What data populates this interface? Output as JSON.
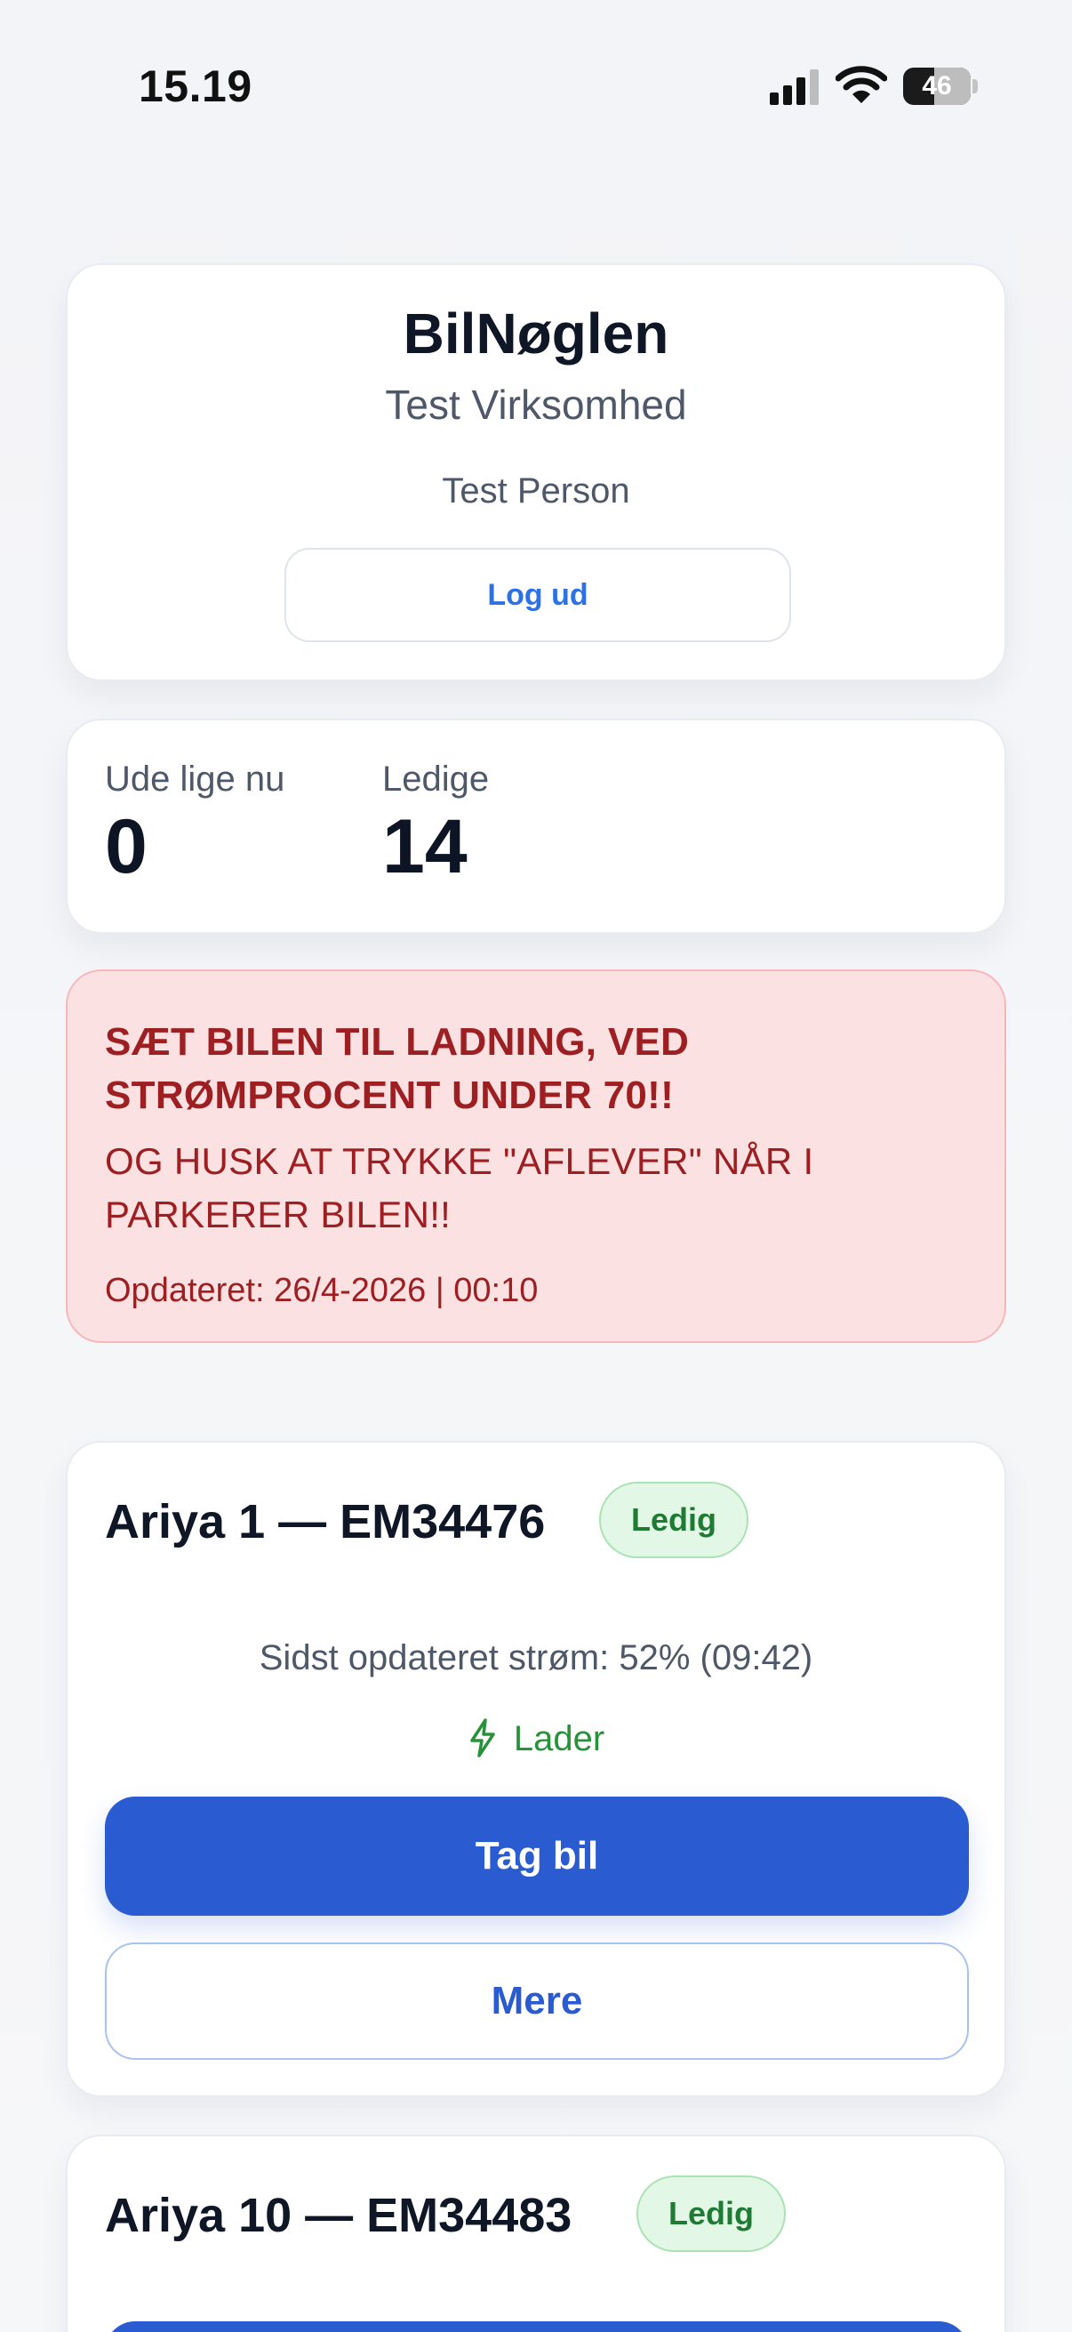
{
  "status_bar": {
    "time": "15.19",
    "battery_level": "46",
    "battery_fraction": 0.46
  },
  "header": {
    "app_title": "BilNøglen",
    "company": "Test Virksomhed",
    "person": "Test Person",
    "logout_label": "Log ud"
  },
  "stats": {
    "out_label": "Ude lige nu",
    "out_value": "0",
    "free_label": "Ledige",
    "free_value": "14"
  },
  "notice": {
    "headline": "SÆT BILEN TIL LADNING, VED STRØMPROCENT UNDER 70!!",
    "body": "OG HUSK AT TRYKKE \"AFLEVER\" NÅR I PARKERER BILEN!!",
    "updated": "Opdateret: 26/4-2026 | 00:10"
  },
  "cars": [
    {
      "title": "Ariya 1 — EM34476",
      "status": "Ledig",
      "battery_update": "Sidst opdateret strøm: 52% (09:42)",
      "charging": "Lader",
      "take_label": "Tag bil",
      "more_label": "Mere"
    },
    {
      "title": "Ariya 10 — EM34483",
      "status": "Ledig"
    }
  ],
  "colors": {
    "accent": "#2a5bd1",
    "link": "#2c72e6",
    "alert_text": "#9e1f22",
    "alert_bg": "#fbe1e2",
    "success": "#1f7a33"
  },
  "icons": [
    "signal-icon",
    "wifi-icon",
    "battery-icon",
    "bolt-icon"
  ]
}
